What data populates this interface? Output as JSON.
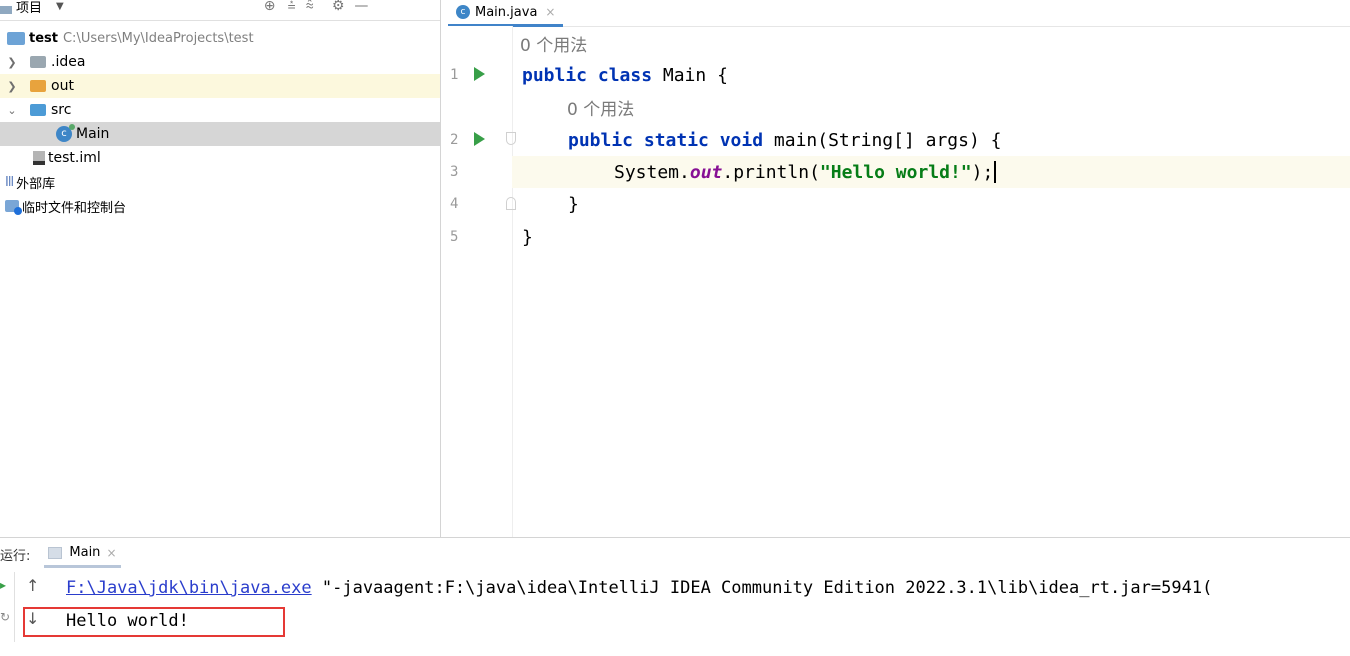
{
  "project": {
    "header_label": "项目",
    "root": {
      "name": "test",
      "path": "C:\\Users\\My\\IdeaProjects\\test"
    },
    "items": [
      {
        "label": ".idea"
      },
      {
        "label": "out"
      },
      {
        "label": "src"
      },
      {
        "label": "Main"
      },
      {
        "label": "test.iml"
      },
      {
        "label": "外部库"
      },
      {
        "label": "临时文件和控制台"
      }
    ]
  },
  "editor": {
    "tab_label": "Main.java",
    "usage_hint": "0 个用法",
    "line_numbers": [
      "1",
      "2",
      "3",
      "4",
      "5"
    ],
    "code": {
      "line1_kw": "public class",
      "line1_rest": " Main {",
      "line2_kw": "public static void",
      "line2_rest": " main(String[] args) {",
      "line3_a": "System.",
      "line3_field": "out",
      "line3_b": ".println(",
      "line3_str": "\"Hello world!\"",
      "line3_c": ");",
      "line4": "}",
      "line5": "}"
    }
  },
  "run": {
    "label": "运行:",
    "tab_label": "Main",
    "command_path": "F:\\Java\\jdk\\bin\\java.exe",
    "command_args": " \"-javaagent:F:\\java\\idea\\IntelliJ IDEA Community Edition 2022.3.1\\lib\\idea_rt.jar=5941(",
    "output": "Hello world!"
  },
  "colors": {
    "accent": "#4083c9",
    "run_green": "#389f48",
    "highlight_red": "#e53935"
  }
}
